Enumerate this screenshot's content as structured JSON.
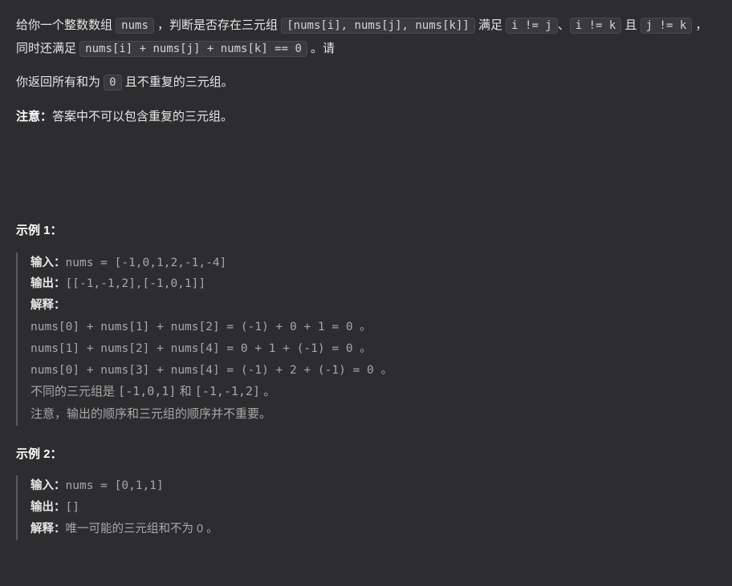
{
  "intro": {
    "p1_seg1": "给你一个整数数组 ",
    "code1": "nums",
    "p1_seg2": " ，判断是否存在三元组 ",
    "code2": "[nums[i], nums[j], nums[k]]",
    "p1_seg3": " 满足 ",
    "code3": "i != j",
    "p1_seg4": "、",
    "code4": "i != k",
    "p1_seg5": " 且 ",
    "code5": "j != k",
    "p1_seg6": " ，同时还满足 ",
    "code6": "nums[i] + nums[j] + nums[k] == 0",
    "p1_seg7": " 。请",
    "p2_seg1": "你返回所有和为 ",
    "code7": "0",
    "p2_seg2": " 且不重复的三元组。",
    "note_label": "注意：",
    "note_text": "答案中不可以包含重复的三元组。"
  },
  "example1": {
    "title": "示例 1：",
    "input_label": "输入：",
    "input_value": "nums = [-1,0,1,2,-1,-4]",
    "output_label": "输出：",
    "output_value": "[[-1,-1,2],[-1,0,1]]",
    "explain_label": "解释：",
    "explain_lines": [
      "nums[0] + nums[1] + nums[2] = (-1) + 0 + 1 = 0 。",
      "nums[1] + nums[2] + nums[4] = 0 + 1 + (-1) = 0 。",
      "nums[0] + nums[3] + nums[4] = (-1) + 2 + (-1) = 0 。"
    ],
    "note1_pre": "不同的三元组是 ",
    "note1_code1": "[-1,0,1]",
    "note1_mid": " 和 ",
    "note1_code2": "[-1,-1,2]",
    "note1_suf": " 。",
    "note2": "注意，输出的顺序和三元组的顺序并不重要。"
  },
  "example2": {
    "title": "示例 2：",
    "input_label": "输入：",
    "input_value": "nums = [0,1,1]",
    "output_label": "输出：",
    "output_value": "[]",
    "explain_label": "解释：",
    "explain_text": "唯一可能的三元组和不为 0 。"
  }
}
